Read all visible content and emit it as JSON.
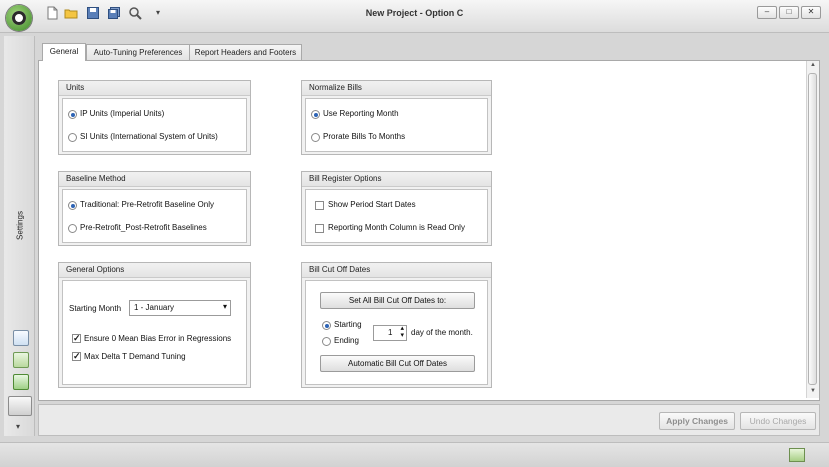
{
  "window": {
    "title": "New Project - Option C"
  },
  "quick_access": [
    "new-file-icon",
    "open-folder-icon",
    "save-icon",
    "save-all-icon",
    "search-icon",
    "dropdown-arrow-icon"
  ],
  "window_controls": {
    "minimize": "–",
    "maximize": "□",
    "close": "✕"
  },
  "left_rail": {
    "label": "Settings",
    "icons": [
      "edit-icon",
      "grid-icon",
      "upload-icon",
      "settings-panel-icon"
    ],
    "chevron": "▾"
  },
  "tabs": [
    {
      "label": "General",
      "active": true
    },
    {
      "label": "Auto-Tuning Preferences",
      "active": false
    },
    {
      "label": "Report Headers and Footers",
      "active": false
    }
  ],
  "units": {
    "title": "Units",
    "options": [
      {
        "label": "IP Units (Imperial Units)",
        "selected": true
      },
      {
        "label": "SI Units (International System of Units)",
        "selected": false
      }
    ]
  },
  "normalize_bills": {
    "title": "Normalize Bills",
    "options": [
      {
        "label": "Use Reporting Month",
        "selected": true
      },
      {
        "label": "Prorate Bills To Months",
        "selected": false
      }
    ]
  },
  "baseline_method": {
    "title": "Baseline Method",
    "options": [
      {
        "label": "Traditional: Pre-Retrofit Baseline Only",
        "selected": true
      },
      {
        "label": "Pre-Retrofit_Post-Retrofit Baselines",
        "selected": false
      }
    ]
  },
  "bill_register": {
    "title": "Bill Register Options",
    "options": [
      {
        "label": "Show Period Start Dates",
        "checked": false
      },
      {
        "label": "Reporting Month Column is Read Only",
        "checked": false
      }
    ]
  },
  "general_options": {
    "title": "General Options",
    "starting_month_label": "Starting Month",
    "starting_month_value": "1 - January",
    "checks": [
      {
        "label": "Ensure 0 Mean Bias Error in Regressions",
        "checked": true
      },
      {
        "label": "Max Delta T Demand Tuning",
        "checked": true
      }
    ]
  },
  "bill_cutoff": {
    "title": "Bill Cut Off Dates",
    "set_all_label": "Set All Bill Cut Off Dates to:",
    "starting_label": "Starting",
    "ending_label": "Ending",
    "starting_selected": true,
    "day_value": "1",
    "day_suffix": "day of the month.",
    "automatic_label": "Automatic Bill Cut Off Dates"
  },
  "footer": {
    "apply_label": "Apply Changes",
    "undo_label": "Undo Changes"
  },
  "colors": {
    "radio_dot": "#2e64b5",
    "disabled_text": "#9a9a9a"
  }
}
